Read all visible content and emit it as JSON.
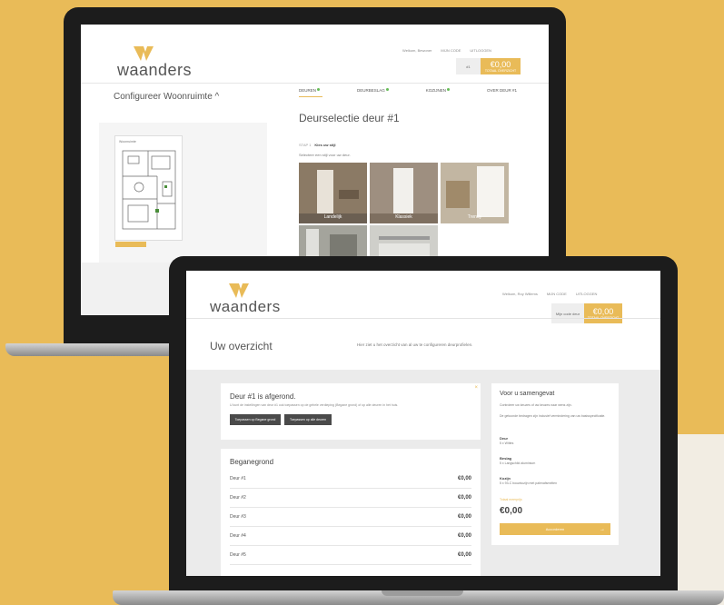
{
  "back": {
    "logo": "waanders",
    "nav": [
      "Welkom, Bewoner",
      "MIJN CODE",
      "UITLOGGEN"
    ],
    "price_box": {
      "label": "#1",
      "amount": "€0,00",
      "sub": "TOTAAL OVERZICHT"
    },
    "configure_title": "Configureer Woonruimte ^",
    "floorplan_title": "Woonruimte",
    "tabs": [
      "DEUREN",
      "DEURBESLAG",
      "KOZIJNEN",
      "OVER DEUR #1"
    ],
    "title": "Deurselectie deur #1",
    "step_label": "STAP 1",
    "step_name": "Kies uw stijl",
    "subtitle": "Selecteer een stijl voor uw deur.",
    "doors": [
      {
        "label": "Landelijk",
        "color": "#8b7a65"
      },
      {
        "label": "Klassiek",
        "color": "#9e8f80"
      },
      {
        "label": "Trendy",
        "color": "#c2b6a2"
      },
      {
        "label": "",
        "color": "#a4a49c"
      },
      {
        "label": "",
        "color": "#cfcfca"
      }
    ]
  },
  "front": {
    "logo": "waanders",
    "nav": [
      "Welkom, Roy Willems",
      "MIJN CODE",
      "UITLOGGEN"
    ],
    "greybox_label": "Mijn code deur",
    "price_box": {
      "amount": "€0,00",
      "sub": "TOTAAL OVERZICHT"
    },
    "page_title": "Uw overzicht",
    "page_note": "Hier ziet u het overzicht van al uw te configureren deurprofielen.",
    "done_card": {
      "title": "Deur #1 is afgerond.",
      "text": "U kunt de instellingen van deur #1 ook toepassen op de gehele verdieping (Begane grond) of op alle deuren in het huis.",
      "btn1": "Toepassen op Begane grond",
      "btn2": "Toepassen op alle deuren",
      "close": "×"
    },
    "ground_floor": {
      "title": "Beganegrond",
      "rows": [
        {
          "name": "Deur #1",
          "price": "€0,00"
        },
        {
          "name": "Deur #2",
          "price": "€0,00"
        },
        {
          "name": "Deur #3",
          "price": "€0,00"
        },
        {
          "name": "Deur #4",
          "price": "€0,00"
        },
        {
          "name": "Deur #5",
          "price": "€0,00"
        }
      ]
    },
    "summary": {
      "title": "Voor u samengevat",
      "line1": "Controleer uw keuzes of uw keuzes naar wens zijn.",
      "line2": "De getoonde bedragen zijn inclusief vermindering van uw basisspecificatie.",
      "sections": [
        {
          "heading": "Deur",
          "value": "5 x Wittes"
        },
        {
          "heading": "Beslag",
          "value": "5 x Langschild aluminium"
        },
        {
          "heading": "Kozijn",
          "value": "5 x 93-C bouwkozijn met palenafsmelten"
        }
      ],
      "total_label": "Totaal meerprijs",
      "total": "€0,00",
      "button": "Accorderen",
      "button_arrow": "→"
    }
  },
  "colors": {
    "accent": "#e9bb58",
    "background": "#e9bb58"
  }
}
